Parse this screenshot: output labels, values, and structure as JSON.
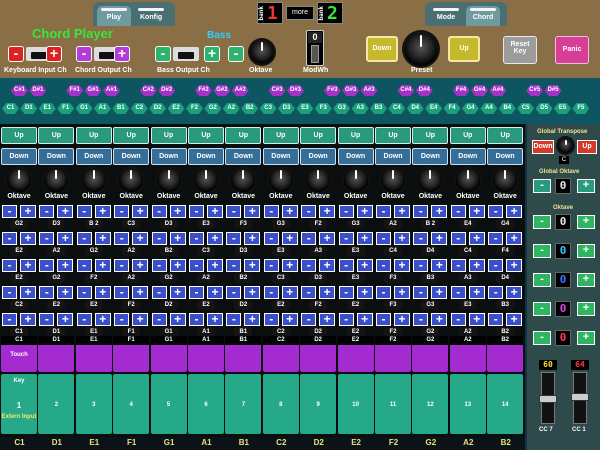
{
  "tabs_left": [
    {
      "label": "Play",
      "active": true
    },
    {
      "label": "Konfig",
      "active": false
    }
  ],
  "tabs_right": [
    {
      "label": "Mode",
      "active": false
    },
    {
      "label": "Chord",
      "active": true
    }
  ],
  "header": {
    "bank_label": "bank",
    "bank_left": "1",
    "more_label": "more",
    "bank_right": "2"
  },
  "title": "Chord Player",
  "keyboard_input_label": "Keyboard Input Ch",
  "chord_output_label": "Chord Output Ch",
  "bass_title": "Bass",
  "bass_output_label": "Bass Output Ch",
  "oktave_label": "Oktave",
  "modwh_label": "ModWh",
  "modwh_value": "0",
  "preset": {
    "down": "Down",
    "up": "Up",
    "label": "Preset"
  },
  "reset_key": "Reset Key",
  "panic": "Panic",
  "black_keys": [
    "C#1",
    "D#1",
    "F#1",
    "G#1",
    "A#1",
    "C#2",
    "D#2",
    "F#2",
    "G#2",
    "A#2",
    "C#3",
    "D#3",
    "F#3",
    "G#3",
    "A#3",
    "C#4",
    "D#4",
    "F#4",
    "G#4",
    "A#4",
    "C#5",
    "D#5"
  ],
  "white_keys": [
    "C1",
    "D1",
    "E1",
    "F1",
    "G1",
    "A1",
    "B1",
    "C2",
    "D2",
    "E2",
    "F2",
    "G2",
    "A2",
    "B2",
    "C3",
    "D3",
    "E3",
    "F3",
    "G3",
    "A3",
    "B3",
    "C4",
    "D4",
    "E4",
    "F4",
    "G4",
    "A4",
    "B4",
    "C5",
    "D5",
    "E5",
    "F5"
  ],
  "col_up": "Up",
  "col_down": "Down",
  "col_oktave": "Oktave",
  "columns": [
    {
      "notes": [
        "G2",
        "E2",
        "E2",
        "C2",
        "C1"
      ],
      "touch": "C1",
      "pad": "1",
      "bottom": "C1"
    },
    {
      "notes": [
        "D3",
        "A2",
        "G2",
        "E2",
        "D1"
      ],
      "touch": "D1",
      "pad": "2",
      "bottom": "D1"
    },
    {
      "notes": [
        "B 2",
        "G2",
        "F2",
        "E2",
        "E1"
      ],
      "touch": "E1",
      "pad": "3",
      "bottom": "E1"
    },
    {
      "notes": [
        "C3",
        "A2",
        "A2",
        "F2",
        "F1"
      ],
      "touch": "F1",
      "pad": "4",
      "bottom": "F1"
    },
    {
      "notes": [
        "D3",
        "B2",
        "G2",
        "D2",
        "G1"
      ],
      "touch": "G1",
      "pad": "5",
      "bottom": "G1"
    },
    {
      "notes": [
        "E3",
        "C3",
        "A2",
        "E2",
        "A1"
      ],
      "touch": "A1",
      "pad": "6",
      "bottom": "A1"
    },
    {
      "notes": [
        "F3",
        "D3",
        "B2",
        "D2",
        "B1"
      ],
      "touch": "B1",
      "pad": "7",
      "bottom": "B1"
    },
    {
      "notes": [
        "G3",
        "E3",
        "C3",
        "E2",
        "C2"
      ],
      "touch": "C2",
      "pad": "8",
      "bottom": "C2"
    },
    {
      "notes": [
        "F2",
        "A3",
        "D3",
        "F2",
        "D2"
      ],
      "touch": "D2",
      "pad": "9",
      "bottom": "D2"
    },
    {
      "notes": [
        "G3",
        "E3",
        "E3",
        "E2",
        "E2"
      ],
      "touch": "E2",
      "pad": "10",
      "bottom": "E2"
    },
    {
      "notes": [
        "A2",
        "C4",
        "F3",
        "F3",
        "F2"
      ],
      "touch": "F2",
      "pad": "11",
      "bottom": "F2"
    },
    {
      "notes": [
        "B 2",
        "D4",
        "B3",
        "G3",
        "G2"
      ],
      "touch": "G2",
      "pad": "12",
      "bottom": "G2"
    },
    {
      "notes": [
        "E4",
        "C4",
        "A3",
        "E3",
        "A2"
      ],
      "touch": "A2",
      "pad": "13",
      "bottom": "A2"
    },
    {
      "notes": [
        "G4",
        "F4",
        "D4",
        "B3",
        "B2"
      ],
      "touch": "B2",
      "pad": "14",
      "bottom": "B2"
    }
  ],
  "touch_label": "Touch",
  "key_label": "Key",
  "extern_label": "Extern Input",
  "right": {
    "global_transpose": "Global Transpose",
    "down": "Down",
    "up": "Up",
    "transpose_value": "C",
    "global_oktave": "Global Oktave",
    "global_oktave_value": "0",
    "oktave": "Oktave",
    "oktave_values": [
      "0",
      "0",
      "0",
      "0",
      "0"
    ],
    "oktave_colors": [
      "#e6e6e6",
      "#36c4ff",
      "#3a78ff",
      "#d04ae0",
      "#ff3a55"
    ],
    "fader1_value": "60",
    "fader2_value": "64",
    "cc1": "CC 7",
    "cc2": "CC 1"
  }
}
